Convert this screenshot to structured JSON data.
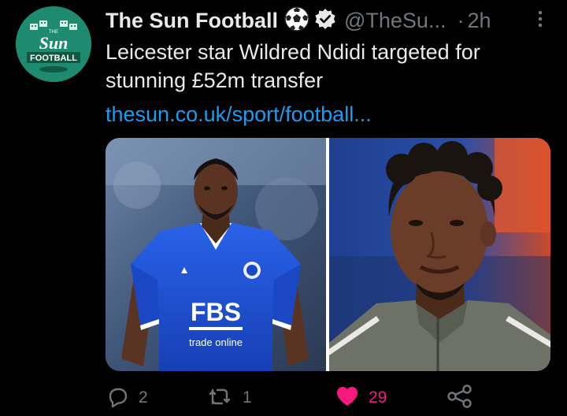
{
  "tweet": {
    "author_name": "The Sun Football",
    "handle": "@TheSu...",
    "separator": "·",
    "time": "2h",
    "text_lines": [
      "Leicester star Wildred Ndidi targeted for",
      "stunning £52m transfer"
    ],
    "link_text": "thesun.co.uk/sport/football...",
    "avatar": {
      "logo_text": "Sun",
      "logo_small": "THE",
      "logo_sub": "FOOTBALL",
      "background": "#1e8a6f"
    },
    "media": {
      "left_photo": {
        "shirt_sponsor": "FBS",
        "shirt_sub": "trade online",
        "shirt_color": "#1c4fd6"
      },
      "right_photo": {
        "jacket_color": "#6e7266"
      }
    },
    "actions": {
      "reply_count": "2",
      "retweet_count": "1",
      "like_count": "29"
    },
    "icons": {
      "reply": "reply-icon",
      "retweet": "retweet-icon",
      "like": "heart-icon",
      "share": "share-icon",
      "verified": "verified-badge-icon",
      "emoji": "soccer-ball-emoji",
      "more": "more-options-icon"
    },
    "colors": {
      "background": "#000000",
      "text": "#e7e9ea",
      "secondary": "#71767b",
      "link": "#1d9bf0",
      "like": "#f91880"
    }
  }
}
